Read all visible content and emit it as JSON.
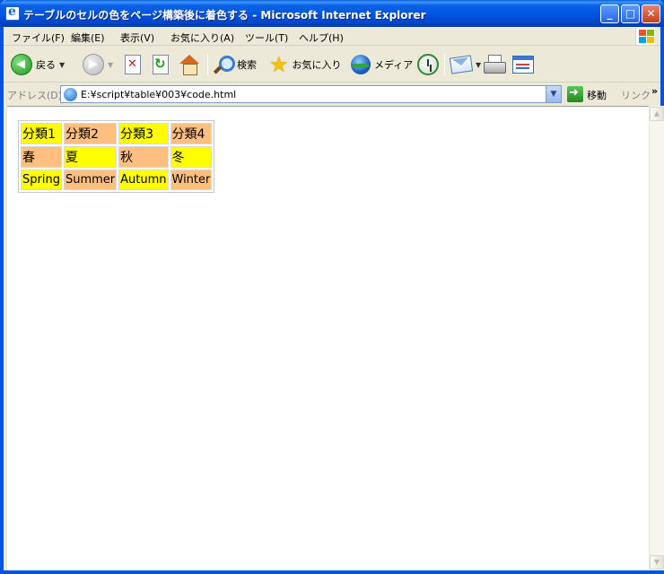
{
  "window": {
    "title": "テーブルのセルの色をページ構築後に着色する - Microsoft Internet Explorer",
    "controls": {
      "minimize": "_",
      "maximize": "□",
      "close": "✕"
    }
  },
  "menu": [
    "ファイル(F)",
    "編集(E)",
    "表示(V)",
    "お気に入り(A)",
    "ツール(T)",
    "ヘルプ(H)"
  ],
  "toolbar": {
    "back_label": "戻る",
    "search_label": "検索",
    "favorites_label": "お気に入り",
    "media_label": "メディア"
  },
  "address": {
    "label": "アドレス(D)",
    "value": "E:¥script¥table¥003¥code.html",
    "go_label": "移動",
    "links_label": "リンク",
    "chevron": "»"
  },
  "table": {
    "rows": [
      [
        {
          "text": "分類1",
          "color": "#ffff00"
        },
        {
          "text": "分類2",
          "color": "#ffbf80"
        },
        {
          "text": "分類3",
          "color": "#ffff00"
        },
        {
          "text": "分類4",
          "color": "#ffbf80"
        }
      ],
      [
        {
          "text": "春",
          "color": "#ffbf80"
        },
        {
          "text": "夏",
          "color": "#ffff00"
        },
        {
          "text": "秋",
          "color": "#ffbf80"
        },
        {
          "text": "冬",
          "color": "#ffff00"
        }
      ],
      [
        {
          "text": "Spring",
          "color": "#ffff00"
        },
        {
          "text": "Summer",
          "color": "#ffbf80"
        },
        {
          "text": "Autumn",
          "color": "#ffff00"
        },
        {
          "text": "Winter",
          "color": "#ffbf80"
        }
      ]
    ]
  },
  "colors": {
    "titlebar": "#0054e3",
    "yellow": "#ffff00",
    "peach": "#ffbf80"
  }
}
